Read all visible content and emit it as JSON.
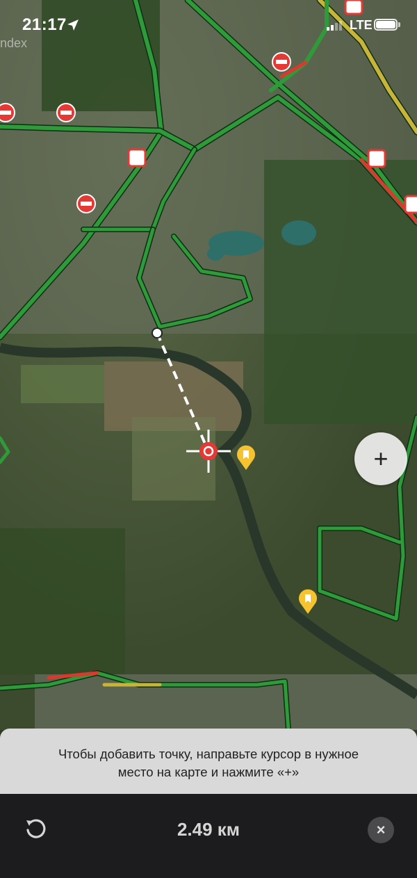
{
  "status": {
    "time": "21:17",
    "network": "LTE"
  },
  "map": {
    "type": "satellite",
    "watermark": "ndex"
  },
  "zoom": {
    "plus_label": "+"
  },
  "hint": {
    "line1": "Чтобы добавить точку, направьте курсор в нужное",
    "line2": "место на карте и нажмите «+»"
  },
  "bottom": {
    "distance": "2.49 км",
    "undo_icon": "undo-icon",
    "close_label": "×"
  },
  "colors": {
    "traffic_green": "#2e9a3a",
    "traffic_yellow": "#c9b43a",
    "traffic_red": "#d83a2f",
    "cursor_red": "#e53935",
    "place_marker": "#f5c330"
  }
}
